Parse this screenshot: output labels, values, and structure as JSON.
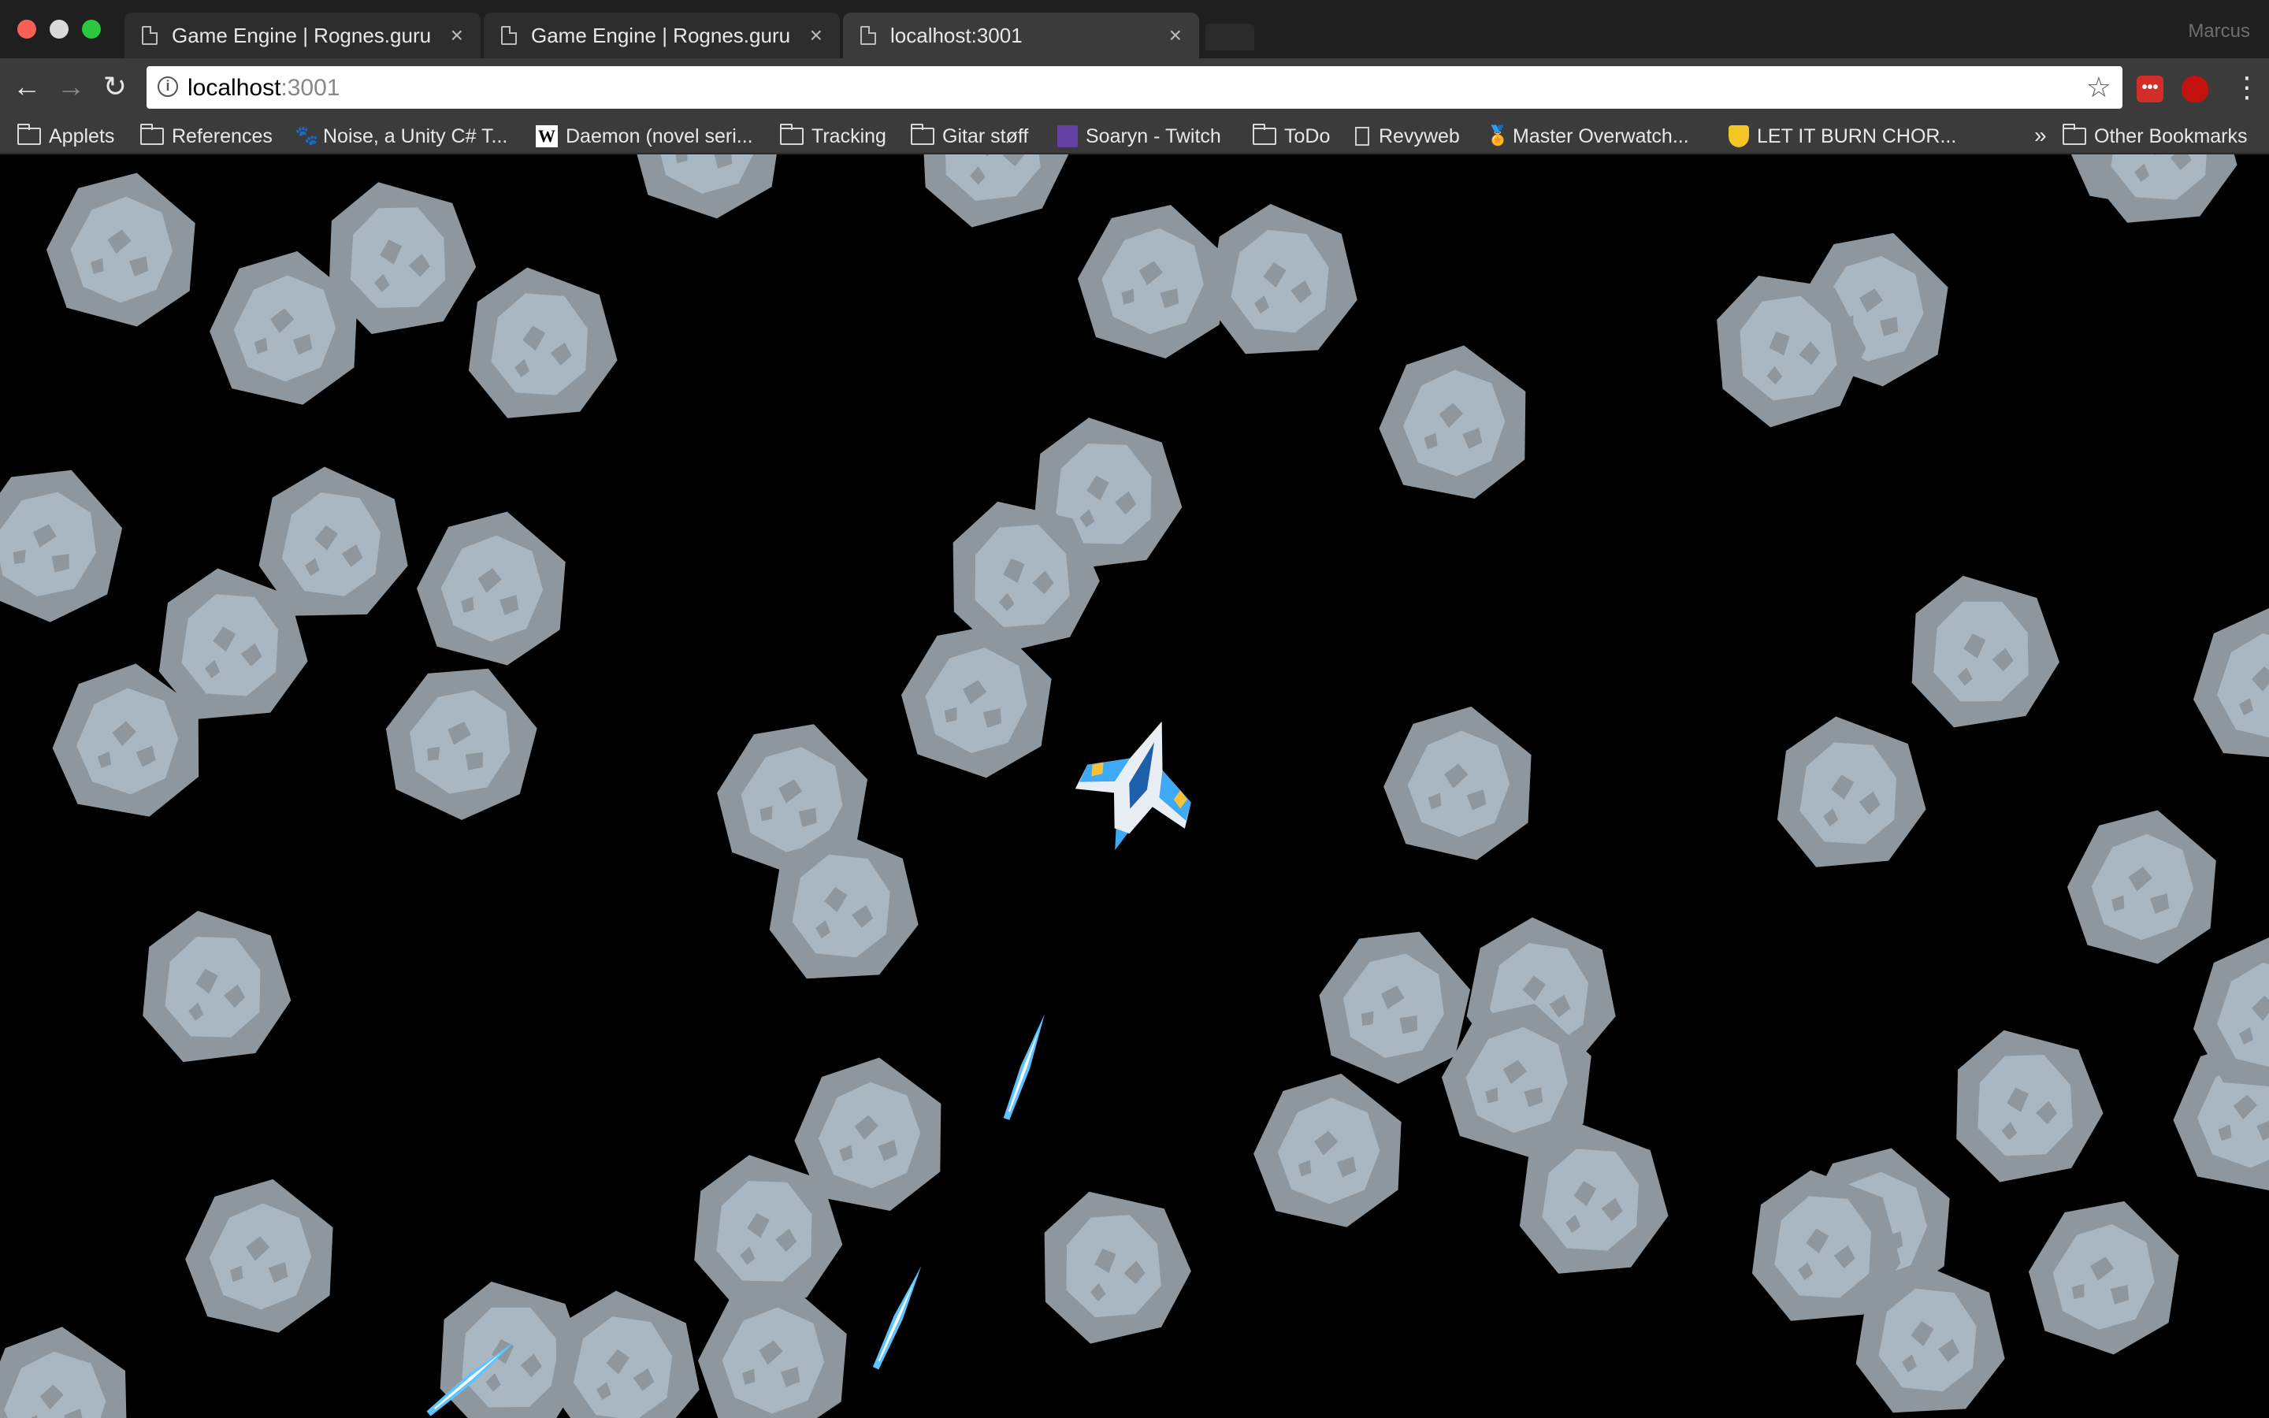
{
  "window": {
    "profile_name": "Marcus"
  },
  "tabs": [
    {
      "title": "Game Engine | Rognes.guru",
      "active": false
    },
    {
      "title": "Game Engine | Rognes.guru",
      "active": false
    },
    {
      "title": "localhost:3001",
      "active": true
    }
  ],
  "address_bar": {
    "host": "localhost",
    "port": ":3001"
  },
  "bookmarks": [
    {
      "label": "Applets",
      "icon": "folder-icon"
    },
    {
      "label": "References",
      "icon": "folder-icon"
    },
    {
      "label": "Noise, a Unity C# T...",
      "icon": "paw-icon"
    },
    {
      "label": "Daemon (novel seri...",
      "icon": "wikipedia-icon"
    },
    {
      "label": "Tracking",
      "icon": "folder-icon"
    },
    {
      "label": "Gitar støff",
      "icon": "folder-icon"
    },
    {
      "label": "Soaryn - Twitch",
      "icon": "twitch-icon"
    },
    {
      "label": "ToDo",
      "icon": "folder-icon"
    },
    {
      "label": "Revyweb",
      "icon": "page-icon"
    },
    {
      "label": "Master Overwatch...",
      "icon": "medal-icon"
    },
    {
      "label": "LET IT BURN CHOR...",
      "icon": "shield-icon"
    }
  ],
  "bookmarks_overflow": "»",
  "other_bookmarks": "Other Bookmarks",
  "game": {
    "background": "#000000",
    "asteroid_fill": "#8e979e",
    "asteroid_inner": "#a9b7c2",
    "ship_colors": {
      "hull": "#e8eef3",
      "wing": "#3fa9f5",
      "accent": "#f5c33b"
    },
    "laser_color": "#5cc4ff"
  }
}
